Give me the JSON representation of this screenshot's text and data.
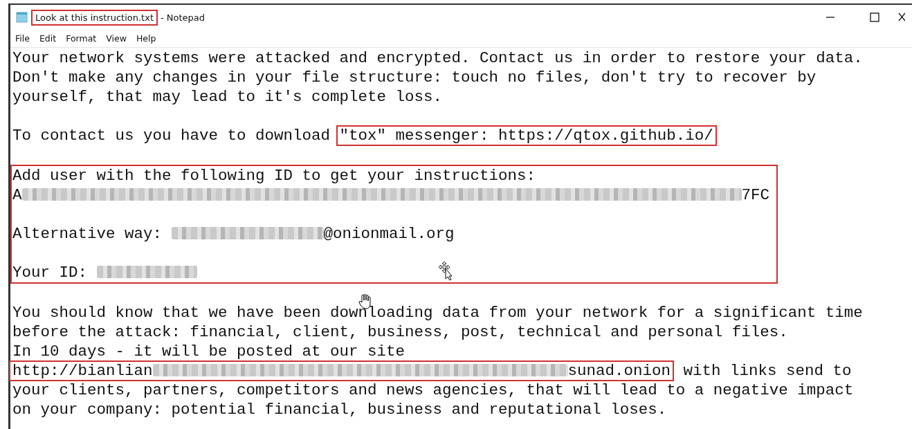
{
  "window": {
    "filename": "Look at this instruction.txt",
    "filename_highlighted": true,
    "app_suffix": "- Notepad"
  },
  "menu": [
    "File",
    "Edit",
    "Format",
    "View",
    "Help"
  ],
  "blocks": [
    {
      "highlighted": false,
      "lines": [
        {
          "kind": "text",
          "segments": [
            {
              "kind": "text",
              "text": "Your network systems were attacked and encrypted. Contact us in order to restore your data."
            }
          ]
        },
        {
          "kind": "text",
          "segments": [
            {
              "kind": "text",
              "text": "Don't make any changes in your file structure: touch no files, don't try to recover by"
            }
          ]
        },
        {
          "kind": "text",
          "segments": [
            {
              "kind": "text",
              "text": "yourself, that may lead to it's complete loss."
            }
          ]
        },
        {
          "kind": "blank"
        },
        {
          "kind": "text",
          "segments": [
            {
              "kind": "text",
              "text": "To contact us you have to download "
            },
            {
              "kind": "boxed",
              "segments": [
                {
                  "kind": "text",
                  "text": "\"tox\" messenger: https://qtox.github.io/"
                }
              ]
            }
          ]
        },
        {
          "kind": "blank"
        }
      ]
    },
    {
      "highlighted": true,
      "lines": [
        {
          "kind": "text",
          "segments": [
            {
              "kind": "text",
              "text": "Add user with the following ID to get your instructions:"
            }
          ]
        },
        {
          "kind": "text",
          "segments": [
            {
              "kind": "text",
              "text": "A"
            },
            {
              "kind": "redacted"
            },
            {
              "kind": "text",
              "text": "7FC"
            }
          ]
        },
        {
          "kind": "blank"
        },
        {
          "kind": "text",
          "segments": [
            {
              "kind": "text",
              "text": "Alternative way: "
            },
            {
              "kind": "redacted"
            },
            {
              "kind": "text",
              "text": "@onionmail.org"
            }
          ]
        },
        {
          "kind": "blank"
        },
        {
          "kind": "text",
          "segments": [
            {
              "kind": "text",
              "text": "Your ID: "
            },
            {
              "kind": "redacted"
            }
          ]
        }
      ]
    },
    {
      "highlighted": false,
      "lines": [
        {
          "kind": "blank"
        },
        {
          "kind": "text",
          "segments": [
            {
              "kind": "text",
              "text": "You should know that we have been downloading data from your network for a significant time"
            }
          ]
        },
        {
          "kind": "text",
          "segments": [
            {
              "kind": "text",
              "text": "before the attack: financial, client, business, post, technical and personal files."
            }
          ]
        },
        {
          "kind": "text",
          "segments": [
            {
              "kind": "text",
              "text": "In 10 days - it will be posted at our site"
            }
          ]
        },
        {
          "kind": "text",
          "segments": [
            {
              "kind": "boxed",
              "segments": [
                {
                  "kind": "text",
                  "text": "http://bianlian"
                },
                {
                  "kind": "redacted"
                },
                {
                  "kind": "text",
                  "text": "sunad.onion"
                }
              ]
            },
            {
              "kind": "text",
              "text": " with links send to"
            }
          ]
        },
        {
          "kind": "text",
          "segments": [
            {
              "kind": "text",
              "text": "your clients, partners, competitors and news agencies, that will lead to a negative impact"
            }
          ]
        },
        {
          "kind": "text",
          "segments": [
            {
              "kind": "text",
              "text": "on your company: potential financial, business and reputational loses."
            }
          ]
        }
      ]
    }
  ]
}
